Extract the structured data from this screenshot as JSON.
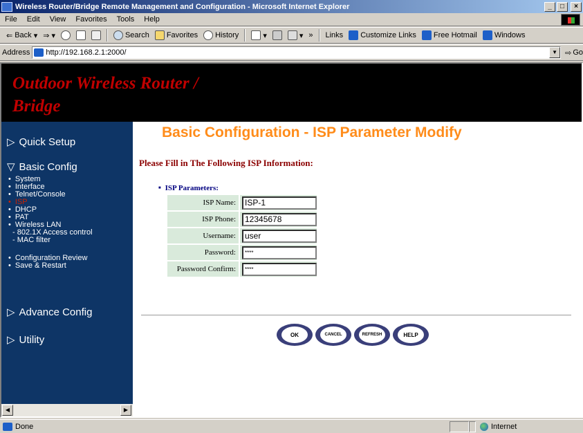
{
  "window": {
    "title": "Wireless Router/Bridge Remote Management and Configuration - Microsoft Internet Explorer",
    "buttons": {
      "minimize": "_",
      "maximize": "□",
      "close": "×"
    }
  },
  "menubar": [
    "File",
    "Edit",
    "View",
    "Favorites",
    "Tools",
    "Help"
  ],
  "toolbar": {
    "back": "Back",
    "search": "Search",
    "favorites": "Favorites",
    "history": "History",
    "chevron": "»",
    "links": "Links",
    "customize_links": "Customize Links",
    "free_hotmail": "Free Hotmail",
    "windows": "Windows"
  },
  "address": {
    "label": "Address",
    "url": "http://192.168.2.1:2000/",
    "go": "Go"
  },
  "banner": {
    "title": "Outdoor Wireless Router / Bridge"
  },
  "sidebar": {
    "quick_setup": "Quick Setup",
    "basic_config": "Basic Config",
    "basic_items": [
      "System",
      "Interface",
      "Telnet/Console",
      "ISP",
      "DHCP",
      "PAT",
      "Wireless LAN"
    ],
    "wireless_sub": [
      "- 802.1X Access control",
      "- MAC filter"
    ],
    "review_items": [
      "Configuration Review",
      "Save & Restart"
    ],
    "advance_config": "Advance Config",
    "utility": "Utility"
  },
  "main": {
    "title": "Basic Configuration - ISP Parameter Modify",
    "prompt": "Please Fill in The Following ISP Information:",
    "section": "ISP Parameters:",
    "fields": {
      "isp_name": {
        "label": "ISP Name:",
        "value": "ISP-1"
      },
      "isp_phone": {
        "label": "ISP Phone:",
        "value": "12345678"
      },
      "username": {
        "label": "Username:",
        "value": "user"
      },
      "password": {
        "label": "Password:",
        "value": "****"
      },
      "password_confirm": {
        "label": "Password Confirm:",
        "value": "****"
      }
    },
    "buttons": {
      "ok": "OK",
      "cancel": "CANCEL",
      "refresh": "REFRESH",
      "help": "HELP"
    }
  },
  "status": {
    "text": "Done",
    "zone": "Internet"
  }
}
